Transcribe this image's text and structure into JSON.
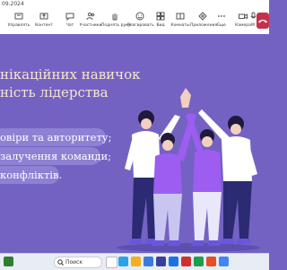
{
  "window": {
    "date_fragment": "09.2024"
  },
  "toolbar": {
    "items": [
      {
        "label": "Управлять",
        "icon": "manage-icon"
      },
      {
        "label": "Контент",
        "icon": "share-content-icon"
      },
      {
        "label": "Чат",
        "icon": "chat-icon"
      },
      {
        "label": "Участники",
        "icon": "participants-icon"
      },
      {
        "label": "Поднять руку",
        "icon": "raise-hand-icon"
      },
      {
        "label": "Реагировать",
        "icon": "react-icon"
      },
      {
        "label": "Вид",
        "icon": "view-icon"
      },
      {
        "label": "Комнаты",
        "icon": "rooms-icon"
      },
      {
        "label": "Приложения",
        "icon": "apps-icon"
      },
      {
        "label": "Еще",
        "icon": "more-icon"
      },
      {
        "label": "Камера",
        "icon": "camera-icon"
      },
      {
        "label": "М",
        "icon": "microphone-icon"
      }
    ],
    "end_call_icon": "end-call-icon"
  },
  "slide": {
    "title_line1": "нікаційних навичок",
    "title_line2": "ність лідерства",
    "bullets": [
      "овіри та авторитету;",
      "залучення команди;",
      "конфліктів."
    ]
  },
  "taskbar": {
    "search_placeholder": "Поиск"
  },
  "colors": {
    "slide_bg": "#7462c3",
    "title": "#f7e6c9",
    "pill": "#8e80d3",
    "end_call": "#c4314b"
  }
}
